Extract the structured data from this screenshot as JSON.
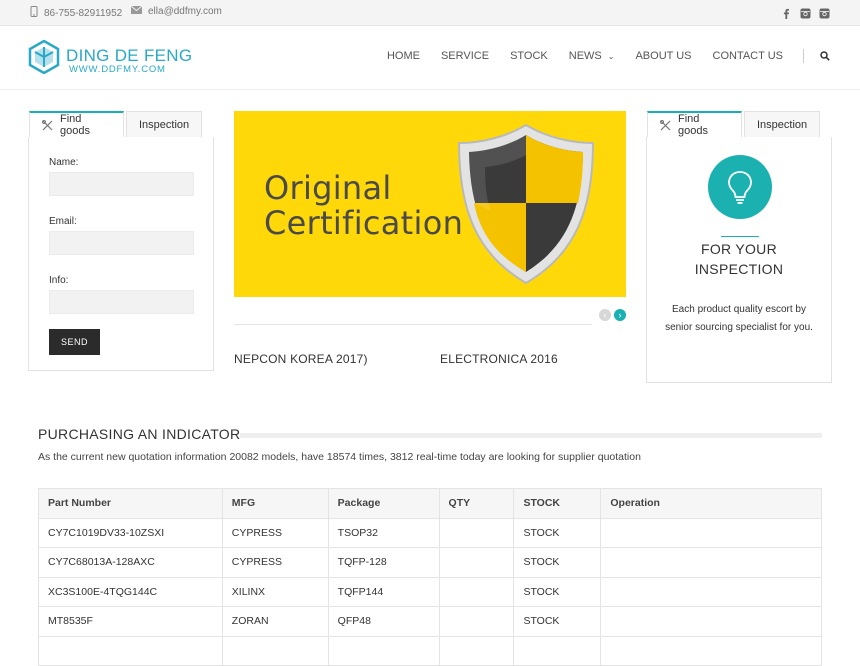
{
  "topbar": {
    "phone": "86-755-82911952",
    "email": "ella@ddfmy.com",
    "social_icons": [
      "facebook-icon",
      "instagram-icon",
      "instagram-icon"
    ]
  },
  "header": {
    "brand": "DING DE FENG",
    "brand_sub": "WWW.DDFMY.COM",
    "nav": [
      "HOME",
      "SERVICE",
      "STOCK",
      "NEWS",
      "ABOUT US",
      "CONTACT US"
    ],
    "nav_dropdown_icon": "chevron-down-icon",
    "search_icon": "search-icon"
  },
  "left_widget": {
    "tabs": [
      "Find goods",
      "Inspection"
    ],
    "fields": [
      {
        "label": "Name:"
      },
      {
        "label": "Email:"
      },
      {
        "label": "Info:"
      }
    ],
    "send": "SEND"
  },
  "slider": {
    "line1": "Original",
    "line2": "Certification",
    "news": [
      "NEPCON KOREA 2017)",
      "ELECTRONICA 2016"
    ]
  },
  "right_widget": {
    "tabs": [
      "Find goods",
      "Inspection"
    ],
    "title_line1": "FOR YOUR",
    "title_line2": "INSPECTION",
    "text": "Each product quality escort by senior sourcing specialist for you."
  },
  "purchasing": {
    "title": "PURCHASING AN INDICATOR",
    "desc": "As the current new quotation information 20082 models, have 18574 times, 3812 real-time today are looking for supplier quotation",
    "headers": [
      "Part Number",
      "MFG",
      "Package",
      "QTY",
      "STOCK",
      "Operation"
    ],
    "rows": [
      [
        "CY7C1019DV33-10ZSXI",
        "CYPRESS",
        "TSOP32",
        "",
        "STOCK",
        ""
      ],
      [
        "CY7C68013A-128AXC",
        "CYPRESS",
        "TQFP-128",
        "",
        "STOCK",
        ""
      ],
      [
        "XC3S100E-4TQG144C",
        "XILINX",
        "TQFP144",
        "",
        "STOCK",
        ""
      ],
      [
        "MT8535F",
        "ZORAN",
        "QFP48",
        "",
        "STOCK",
        ""
      ],
      [
        "",
        "",
        "",
        "",
        "",
        ""
      ]
    ]
  },
  "colors": {
    "accent": "#1bb1b1",
    "brand": "#29a9c7",
    "slider_bg": "#ffd80a"
  }
}
